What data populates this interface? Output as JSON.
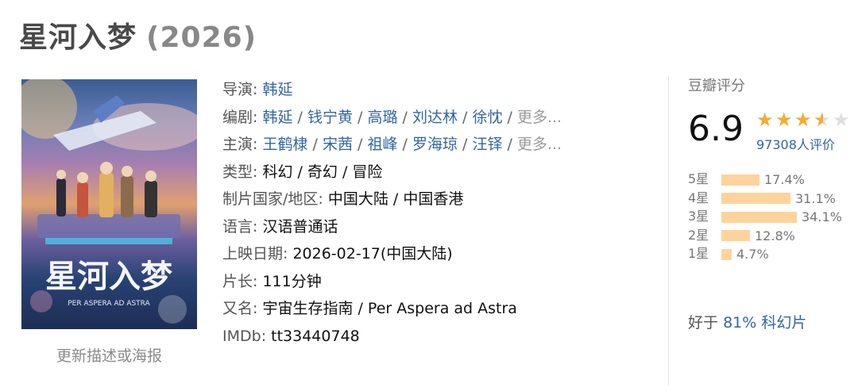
{
  "movie": {
    "title": "星河入梦",
    "year": "(2026)"
  },
  "poster": {
    "alt_text": "星河入梦 poster",
    "update_link": "更新描述或海报"
  },
  "info": {
    "director_label": "导演:",
    "directors": [
      "韩延"
    ],
    "writers_label": "编剧:",
    "writers": [
      "韩延",
      "钱宁黄",
      "高璐",
      "刘达林",
      "徐忱"
    ],
    "cast_label": "主演:",
    "cast": [
      "王鹤棣",
      "宋茜",
      "祖峰",
      "罗海琼",
      "汪铎"
    ],
    "more_text": "更多...",
    "separator": " / ",
    "genre_label": "类型:",
    "genre_value": "科幻 / 奇幻 / 冒险",
    "region_label": "制片国家/地区:",
    "region_value": "中国大陆 / 中国香港",
    "language_label": "语言:",
    "language_value": "汉语普通话",
    "release_label": "上映日期:",
    "release_value": "2026-02-17(中国大陆)",
    "runtime_label": "片长:",
    "runtime_value": "111分钟",
    "aka_label": "又名:",
    "aka_value": "宇宙生存指南 / Per Aspera ad Astra",
    "imdb_label": "IMDb:",
    "imdb_value": "tt33440748"
  },
  "rating": {
    "title": "豆瓣评分",
    "score": "6.9",
    "stars_value": 3.5,
    "stars_max": 5,
    "votes": "97308人评价",
    "distribution": [
      {
        "label": "5星",
        "percent": 17.4,
        "text": "17.4%"
      },
      {
        "label": "4星",
        "percent": 31.1,
        "text": "31.1%"
      },
      {
        "label": "3星",
        "percent": 34.1,
        "text": "34.1%"
      },
      {
        "label": "2星",
        "percent": 12.8,
        "text": "12.8%"
      },
      {
        "label": "1星",
        "percent": 4.7,
        "text": "4.7%"
      }
    ],
    "better_prefix": "好于",
    "better_link": "81% 科幻片"
  },
  "colors": {
    "link": "#3366a0",
    "star": "#f6ab33",
    "bar": "#ffd39b"
  }
}
